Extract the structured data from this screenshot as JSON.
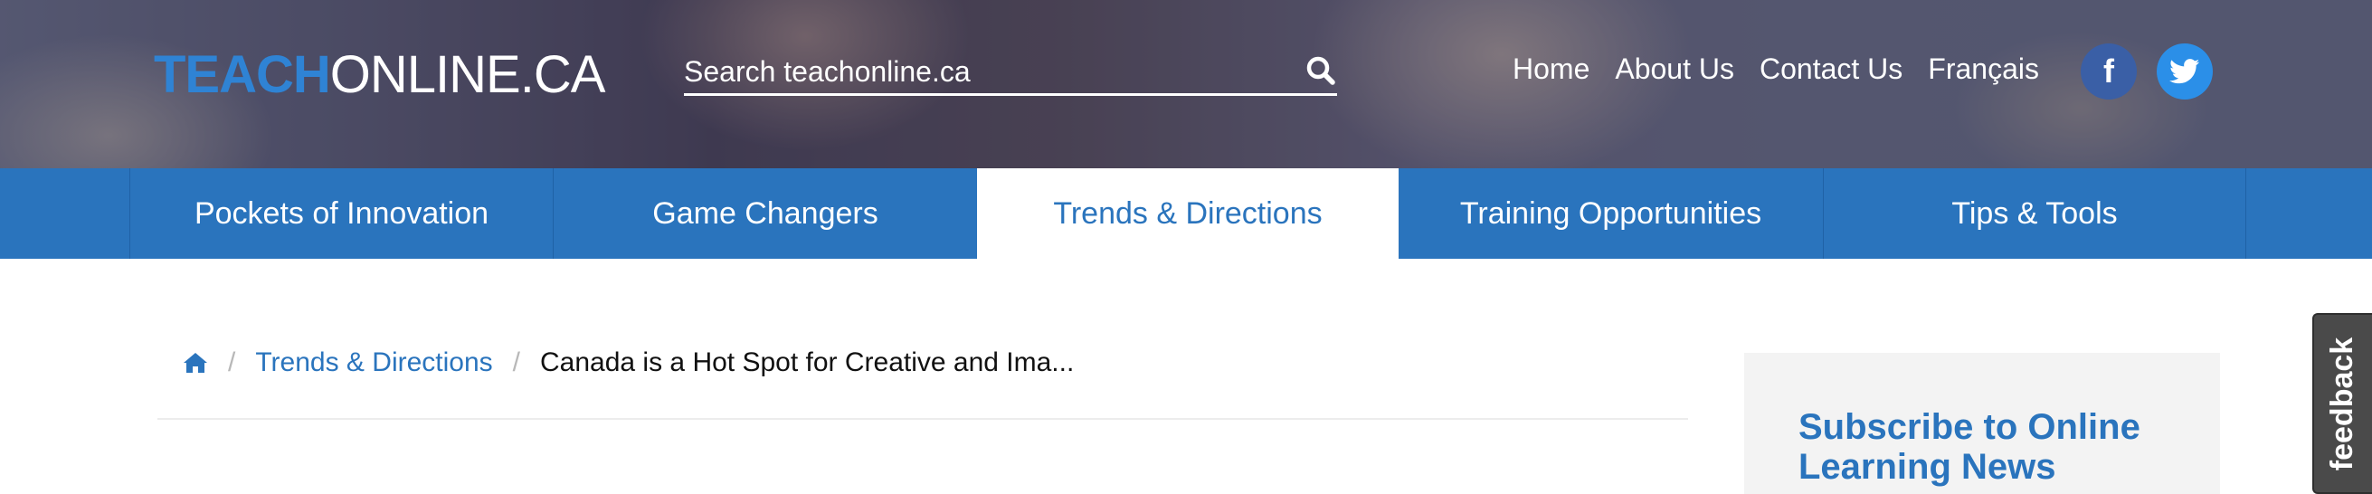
{
  "header": {
    "logo_part1": "TEACH",
    "logo_part2": "ONLINE.CA",
    "search_placeholder": "Search teachonline.ca",
    "nav": [
      "Home",
      "About Us",
      "Contact Us",
      "Français"
    ],
    "social": {
      "facebook_glyph": "f",
      "twitter_icon": "twitter-bird-icon"
    }
  },
  "categories": [
    {
      "label": "Pockets of Innovation",
      "active": false
    },
    {
      "label": "Game Changers",
      "active": false
    },
    {
      "label": "Trends & Directions",
      "active": true
    },
    {
      "label": "Training Opportunities",
      "active": false
    },
    {
      "label": "Tips & Tools",
      "active": false
    }
  ],
  "breadcrumb": {
    "home_icon": "home-icon",
    "link": "Trends & Directions",
    "current": "Canada is a Hot Spot for Creative and Ima..."
  },
  "sidebar": {
    "subscribe_title": "Subscribe to Online Learning News"
  },
  "feedback_tab": {
    "label": "feedback"
  },
  "colors": {
    "brand_blue": "#2a74bd",
    "logo_blue": "#2f83d4",
    "facebook": "#3a5fa6",
    "twitter": "#2b8fe8"
  }
}
